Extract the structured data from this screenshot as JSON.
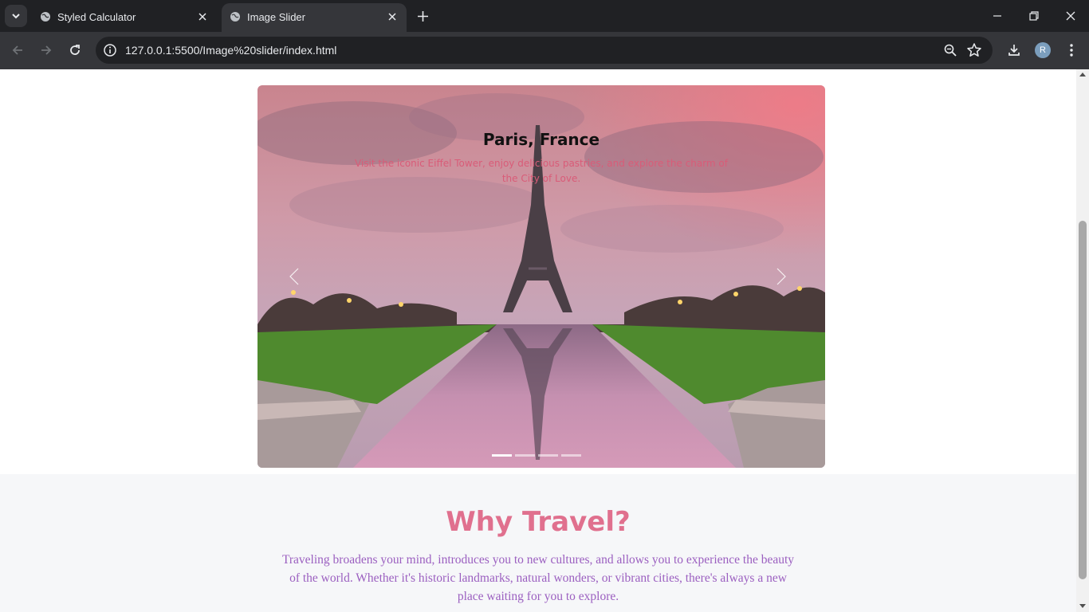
{
  "browser": {
    "tabs": [
      {
        "title": "Styled Calculator",
        "active": false
      },
      {
        "title": "Image Slider",
        "active": true
      }
    ],
    "url": "127.0.0.1:5500/Image%20slider/index.html",
    "profile_initial": "R"
  },
  "slider": {
    "current_slide": {
      "title": "Paris, France",
      "description": "Visit the iconic Eiffel Tower, enjoy delicious pastries, and explore the charm of the City of Love."
    },
    "slide_count": 4,
    "active_index": 0
  },
  "why_section": {
    "heading": "Why Travel?",
    "body": "Traveling broadens your mind, introduces you to new cultures, and allows you to experience the beauty of the world. Whether it's historic landmarks, natural wonders, or vibrant cities, there's always a new place waiting for you to explore."
  },
  "colors": {
    "heading": "#e0708e",
    "body_text": "#9b5fc0",
    "caption_desc": "#d95c78",
    "section_bg": "#f6f7f9"
  }
}
